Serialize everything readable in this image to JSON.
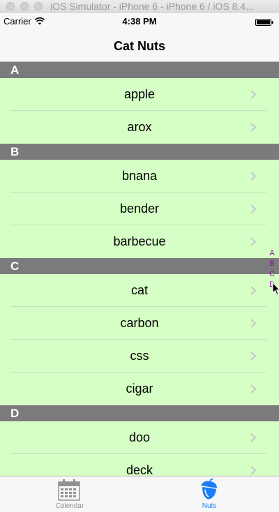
{
  "window": {
    "title": "iOS Simulator - iPhone 6 - iPhone 6 / iOS 8.4..."
  },
  "status_bar": {
    "carrier": "Carrier",
    "time": "4:38 PM"
  },
  "nav_bar": {
    "title": "Cat Nuts"
  },
  "sections": [
    {
      "header": "A",
      "items": [
        "apple",
        "arox"
      ]
    },
    {
      "header": "B",
      "items": [
        "bnana",
        "bender",
        "barbecue"
      ]
    },
    {
      "header": "C",
      "items": [
        "cat",
        "carbon",
        "css",
        "cigar"
      ]
    },
    {
      "header": "D",
      "items": [
        "doo",
        "deck"
      ]
    }
  ],
  "section_index": [
    "A",
    "B",
    "C",
    "D"
  ],
  "tab_bar": {
    "tabs": [
      {
        "label": "Calendar",
        "icon": "calendar-icon",
        "selected": false
      },
      {
        "label": "Nuts",
        "icon": "acorn-icon",
        "selected": true
      }
    ]
  },
  "colors": {
    "row_background": "#d6ffc6",
    "section_header_background": "#7b7b7b",
    "index_color": "#7a1a8c",
    "tab_selected": "#1c7cf4",
    "tab_unselected": "#929292"
  }
}
